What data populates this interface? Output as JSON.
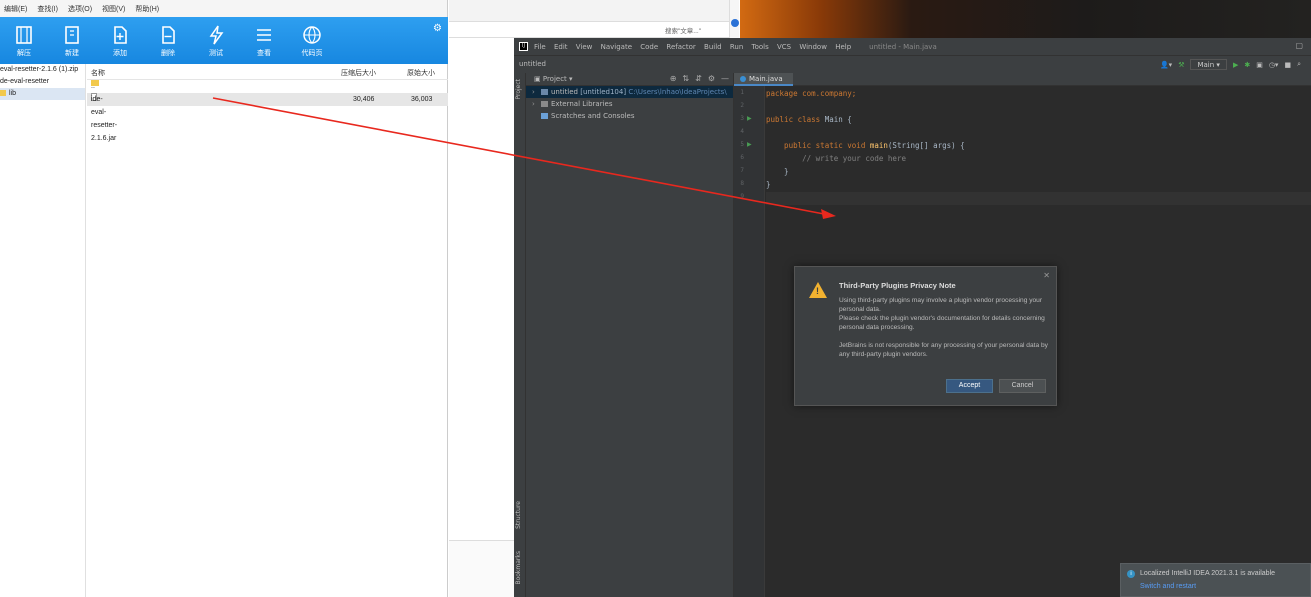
{
  "zip": {
    "menu": [
      "编辑(E)",
      "查找(I)",
      "选项(O)",
      "视图(V)",
      "帮助(H)"
    ],
    "toolbar": [
      {
        "label": "解压",
        "icon": "extract-icon"
      },
      {
        "label": "新建",
        "icon": "new-archive-icon"
      },
      {
        "label": "添加",
        "icon": "add-file-icon"
      },
      {
        "label": "删除",
        "icon": "delete-file-icon"
      },
      {
        "label": "测试",
        "icon": "test-icon"
      },
      {
        "label": "查看",
        "icon": "view-icon"
      },
      {
        "label": "代码页",
        "icon": "codepage-icon"
      }
    ],
    "tree": [
      "eval-resetter-2.1.6 (1).zip",
      "de-eval-resetter",
      "lib"
    ],
    "columns": {
      "name": "名称",
      "compressed": "压缩后大小",
      "original": "原始大小"
    },
    "rows": [
      {
        "name": "..",
        "compressed": "",
        "original": ""
      },
      {
        "name": "ide-eval-resetter-2.1.6.jar",
        "compressed": "30,406",
        "original": "36,003"
      }
    ]
  },
  "browser": {
    "search_placeholder": "搜索\"文章...\""
  },
  "ide": {
    "menu": [
      "File",
      "Edit",
      "View",
      "Navigate",
      "Code",
      "Refactor",
      "Build",
      "Run",
      "Tools",
      "VCS",
      "Window",
      "Help"
    ],
    "window_title": "untitled - Main.java",
    "breadcrumb": "untitled",
    "run_config": "Main",
    "project_panel_title": "Project",
    "tree": [
      {
        "arrow": "›",
        "name": "untitled",
        "module": "[untitled104]",
        "path": "C:\\Users\\lnhao\\IdeaProjects\\"
      },
      {
        "arrow": "›",
        "name": "External Libraries",
        "module": "",
        "path": ""
      },
      {
        "arrow": "",
        "name": "Scratches and Consoles",
        "module": "",
        "path": ""
      }
    ],
    "side_tabs": [
      "Project",
      "Structure",
      "Bookmarks"
    ],
    "editor_tab": "Main.java",
    "code": [
      "package com.company;",
      "",
      "public class Main {",
      "",
      "    public static void main(String[] args) {",
      "        // write your code here",
      "    }",
      "}",
      ""
    ],
    "line_numbers": [
      "1",
      "2",
      "3",
      "4",
      "5",
      "6",
      "7",
      "8",
      "9"
    ]
  },
  "dialog": {
    "title": "Third-Party Plugins Privacy Note",
    "body": [
      "Using third-party plugins may involve a plugin vendor processing your personal data.",
      "Please check the plugin vendor's documentation for details concerning personal data processing.",
      "JetBrains is not responsible for any processing of your personal data by any third-party plugin vendors."
    ],
    "accept": "Accept",
    "cancel": "Cancel"
  },
  "notification": {
    "message": "Localized IntelliJ IDEA 2021.3.1 is available",
    "link": "Switch and restart"
  },
  "colors": {
    "accent_arrow": "#e8281e",
    "toolbar_blue": "#1787e0"
  }
}
